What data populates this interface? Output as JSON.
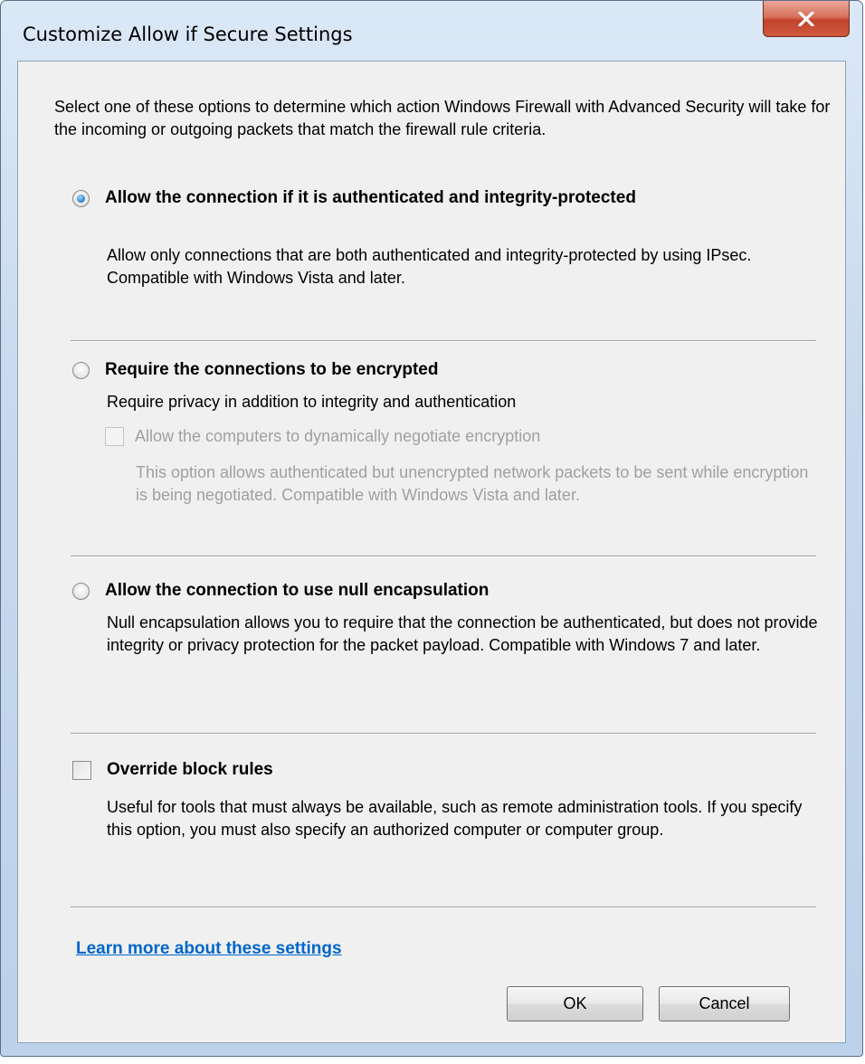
{
  "window": {
    "title": "Customize Allow if Secure Settings",
    "close_icon": "close-icon"
  },
  "intro": "Select one of these options to determine which action Windows Firewall with Advanced Security will take for the incoming or outgoing packets that match the firewall rule criteria.",
  "options": {
    "authenticated": {
      "label": "Allow the connection if it is authenticated and integrity-protected",
      "description": "Allow only connections that are both authenticated and integrity-protected by using IPsec. Compatible with Windows Vista and later.",
      "checked": true
    },
    "encrypted": {
      "label": "Require the connections to be encrypted",
      "description": "Require privacy in addition to integrity and authentication",
      "checked": false,
      "sub_option": {
        "label": "Allow the computers to dynamically negotiate encryption",
        "description": "This option allows authenticated but unencrypted network packets to be sent while encryption is being negotiated. Compatible with Windows Vista and later.",
        "checked": false,
        "enabled": false
      }
    },
    "null_encapsulation": {
      "label": "Allow the connection to use null encapsulation",
      "description": "Null encapsulation allows you to require that the connection be authenticated, but does not provide integrity or privacy protection for the packet payload. Compatible with Windows 7 and later.",
      "checked": false
    },
    "override": {
      "label": "Override block rules",
      "description": "Useful for tools that must always be available, such as remote administration tools. If you specify this option, you must also specify an authorized computer or computer group.",
      "checked": false
    }
  },
  "link": "Learn more about these settings",
  "buttons": {
    "ok": "OK",
    "cancel": "Cancel"
  },
  "colors": {
    "link": "#0066cc",
    "close_button": "#c0422b",
    "dialog_background": "#f0f0f0",
    "disabled_text": "#a0a0a0"
  }
}
